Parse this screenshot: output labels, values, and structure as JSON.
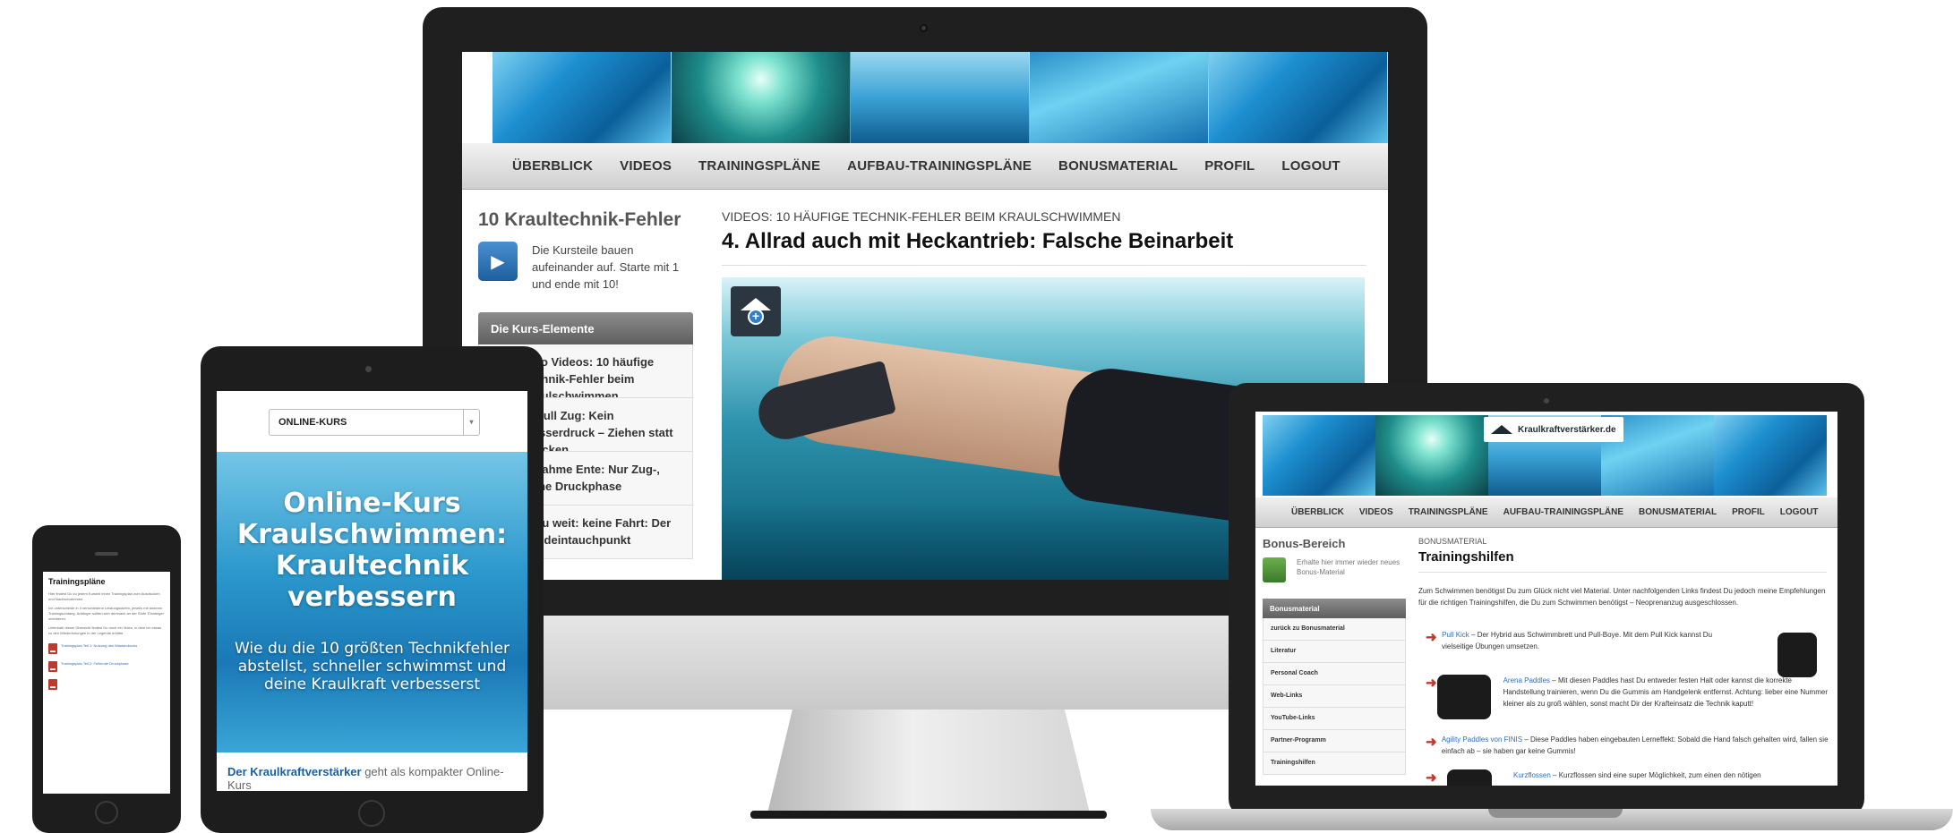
{
  "imac": {
    "nav": [
      "ÜBERBLICK",
      "VIDEOS",
      "TRAININGSPLÄNE",
      "AUFBAU-TRAININGSPLÄNE",
      "BONUSMATERIAL",
      "PROFIL",
      "LOGOUT"
    ],
    "sidebar_title": "10 Kraultechnik-Fehler",
    "sidebar_intro": "Die Kursteile bauen aufeinander auf. Starte mit 1 und ende mit 10!",
    "panel_title": "Die Kurs-Elemente",
    "panel_items": [
      "Intro Videos: 10 häufige Technik-Fehler beim Kraulschwimmen",
      "1. Null Zug: Kein Wasserdruck – Ziehen statt Drücken",
      "2. Lahme Ente: Nur Zug-, keine Druckphase",
      "3. Zu weit: keine Fahrt: Der Handeintauchpunkt"
    ],
    "kicker": "VIDEOS: 10 HÄUFIGE TECHNIK-FEHLER BEIM KRAULSCHWIMMEN",
    "title": "4. Allrad auch mit Heckantrieb: Falsche Beinarbeit"
  },
  "ipad": {
    "select_value": "ONLINE-KURS",
    "hero_title": "Online-Kurs Kraulschwimmen: Kraultechnik verbessern",
    "hero_subtitle": "Wie du die 10 größten Technikfehler abstellst, schneller schwimmst und deine Kraulkraft verbesserst",
    "footer_bold": "Der Kraulkraftverstärker",
    "footer_rest": " geht als kompakter Online-Kurs"
  },
  "iphone": {
    "title": "Trainingspläne",
    "para1": "Hier findest Du zu jedem Kursteil einen Trainingsplan zum Ausdrucken und Nachschwimmen.",
    "para2": "Ich unterscheide in 4 verschiedene Leistungsstufen, jeweils mit anderen Trainingsumfang. Anfänger sollten sich demnach an der Stufe 'Einsteiger' orientieren.",
    "para3": "Unterhalb dieser Übersicht findest Du noch ein Video, in dem ich etwas zu den Wiederholungen in der Legende erkläre.",
    "pdf1": "Trainingsplan Teil 1: Nutzung des Wasserdrucks",
    "pdf2": "Trainingsplan Teil 2: Fehlende Druckphase"
  },
  "macbook": {
    "brand": "Kraulkraftverstärker.de",
    "nav": [
      "ÜBERBLICK",
      "VIDEOS",
      "TRAININGSPLÄNE",
      "AUFBAU-TRAININGSPLÄNE",
      "BONUSMATERIAL",
      "PROFIL",
      "LOGOUT"
    ],
    "sidebar_title": "Bonus-Bereich",
    "sidebar_intro": "Erhalte hier immer wieder neues Bonus-Material",
    "panel_title": "Bonusmaterial",
    "panel_items": [
      "zurück zu Bonusmaterial",
      "Literatur",
      "Personal Coach",
      "Web-Links",
      "YouTube-Links",
      "Partner-Programm",
      "Trainingshilfen"
    ],
    "kicker": "BONUSMATERIAL",
    "title": "Trainingshilfen",
    "lead": "Zum Schwimmen benötigst Du zum Glück nicht viel Material. Unter nachfolgenden Links findest Du jedoch meine Empfehlungen für die richtigen Trainingshilfen, die Du zum Schwimmen benötigst – Neoprenanzug ausgeschlossen.",
    "items": [
      {
        "link": "Pull Kick",
        "text": " – Der Hybrid aus Schwimmbrett und Pull-Boye. Mit dem Pull Kick kannst Du vielseitige Übungen umsetzen."
      },
      {
        "link": "Arena Paddles",
        "text": " – Mit diesen Paddles hast Du entweder festen Halt oder kannst die korrekte Handstellung trainieren, wenn Du die Gummis am Handgelenk entfernst. Achtung: lieber eine Nummer kleiner als zu groß wählen, sonst macht Dir der Krafteinsatz die Technik kaputt!"
      },
      {
        "link": "Agility Paddles von FINIS",
        "text": " – Diese Paddles haben eingebauten Lerneffekt: Sobald die Hand falsch gehalten wird, fallen sie einfach ab – sie haben gar keine Gummis!"
      },
      {
        "link": "Kurzflossen",
        "text": " – Kurzflossen sind eine super Möglichkeit, zum einen den nötigen"
      }
    ]
  }
}
